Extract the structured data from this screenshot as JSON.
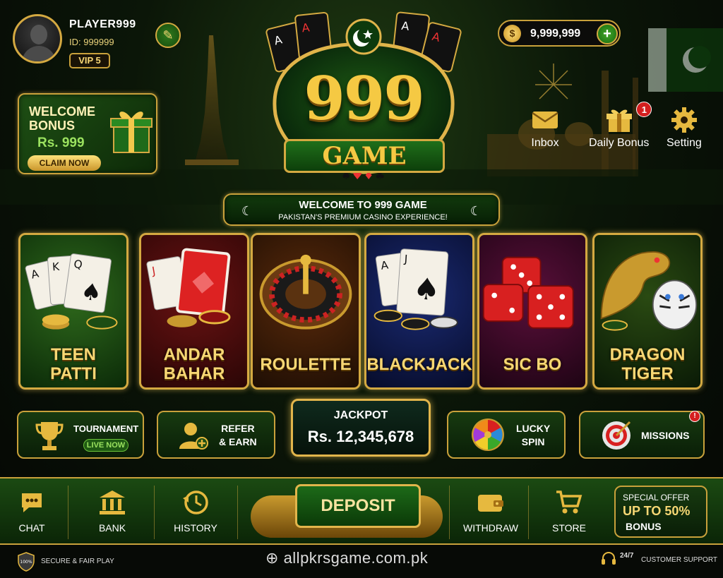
{
  "player": {
    "name": "PLAYER999",
    "id_label": "ID: 999999",
    "vip": "VIP 5"
  },
  "welcome_bonus": {
    "title_line1": "WELCOME",
    "title_line2": "BONUS",
    "amount": "Rs. 999",
    "button": "CLAIM NOW"
  },
  "logo": {
    "number": "999",
    "word": "GAME"
  },
  "balance": {
    "coin_symbol": "$",
    "value": "9,999,999",
    "add_symbol": "+"
  },
  "top_actions": [
    {
      "label": "Inbox",
      "icon": "envelope-icon"
    },
    {
      "label": "Daily Bonus",
      "icon": "gift-icon",
      "badge": "1"
    },
    {
      "label": "Setting",
      "icon": "gear-icon"
    }
  ],
  "banner": {
    "line1": "WELCOME TO 999 GAME",
    "line2": "PAKISTAN'S PREMIUM CASINO EXPERIENCE!"
  },
  "games": [
    {
      "line1": "TEEN",
      "line2": "PATTI"
    },
    {
      "line1": "ANDAR",
      "line2": "BAHAR"
    },
    {
      "line1": "ROULETTE",
      "line2": ""
    },
    {
      "line1": "BLACKJACK",
      "line2": ""
    },
    {
      "line1": "SIC BO",
      "line2": ""
    },
    {
      "line1": "DRAGON",
      "line2": "TIGER"
    }
  ],
  "features": {
    "tournament": {
      "label": "TOURNAMENT",
      "status": "LIVE NOW"
    },
    "refer": {
      "line1": "REFER",
      "line2": "& EARN"
    },
    "jackpot": {
      "label": "JACKPOT",
      "value": "Rs. 12,345,678"
    },
    "lucky_spin": {
      "line1": "LUCKY",
      "line2": "SPIN"
    },
    "missions": {
      "label": "MISSIONS",
      "badge": "!"
    }
  },
  "nav": {
    "chat": "CHAT",
    "bank": "BANK",
    "history": "HISTORY",
    "deposit": "DEPOSIT",
    "withdraw": "WITHDRAW",
    "store": "STORE"
  },
  "offer": {
    "line1": "SPECIAL OFFER",
    "line2": "UP TO 50%",
    "line3": "BONUS"
  },
  "footer": {
    "badge": "100%",
    "secure": "SECURE & FAIR PLAY",
    "url": "allpkrsgame.com.pk",
    "support_247": "24/7",
    "support": "CUSTOMER SUPPORT"
  },
  "colors": {
    "gold": "#d4a941",
    "green": "#1d6a18",
    "background": "#050805"
  }
}
